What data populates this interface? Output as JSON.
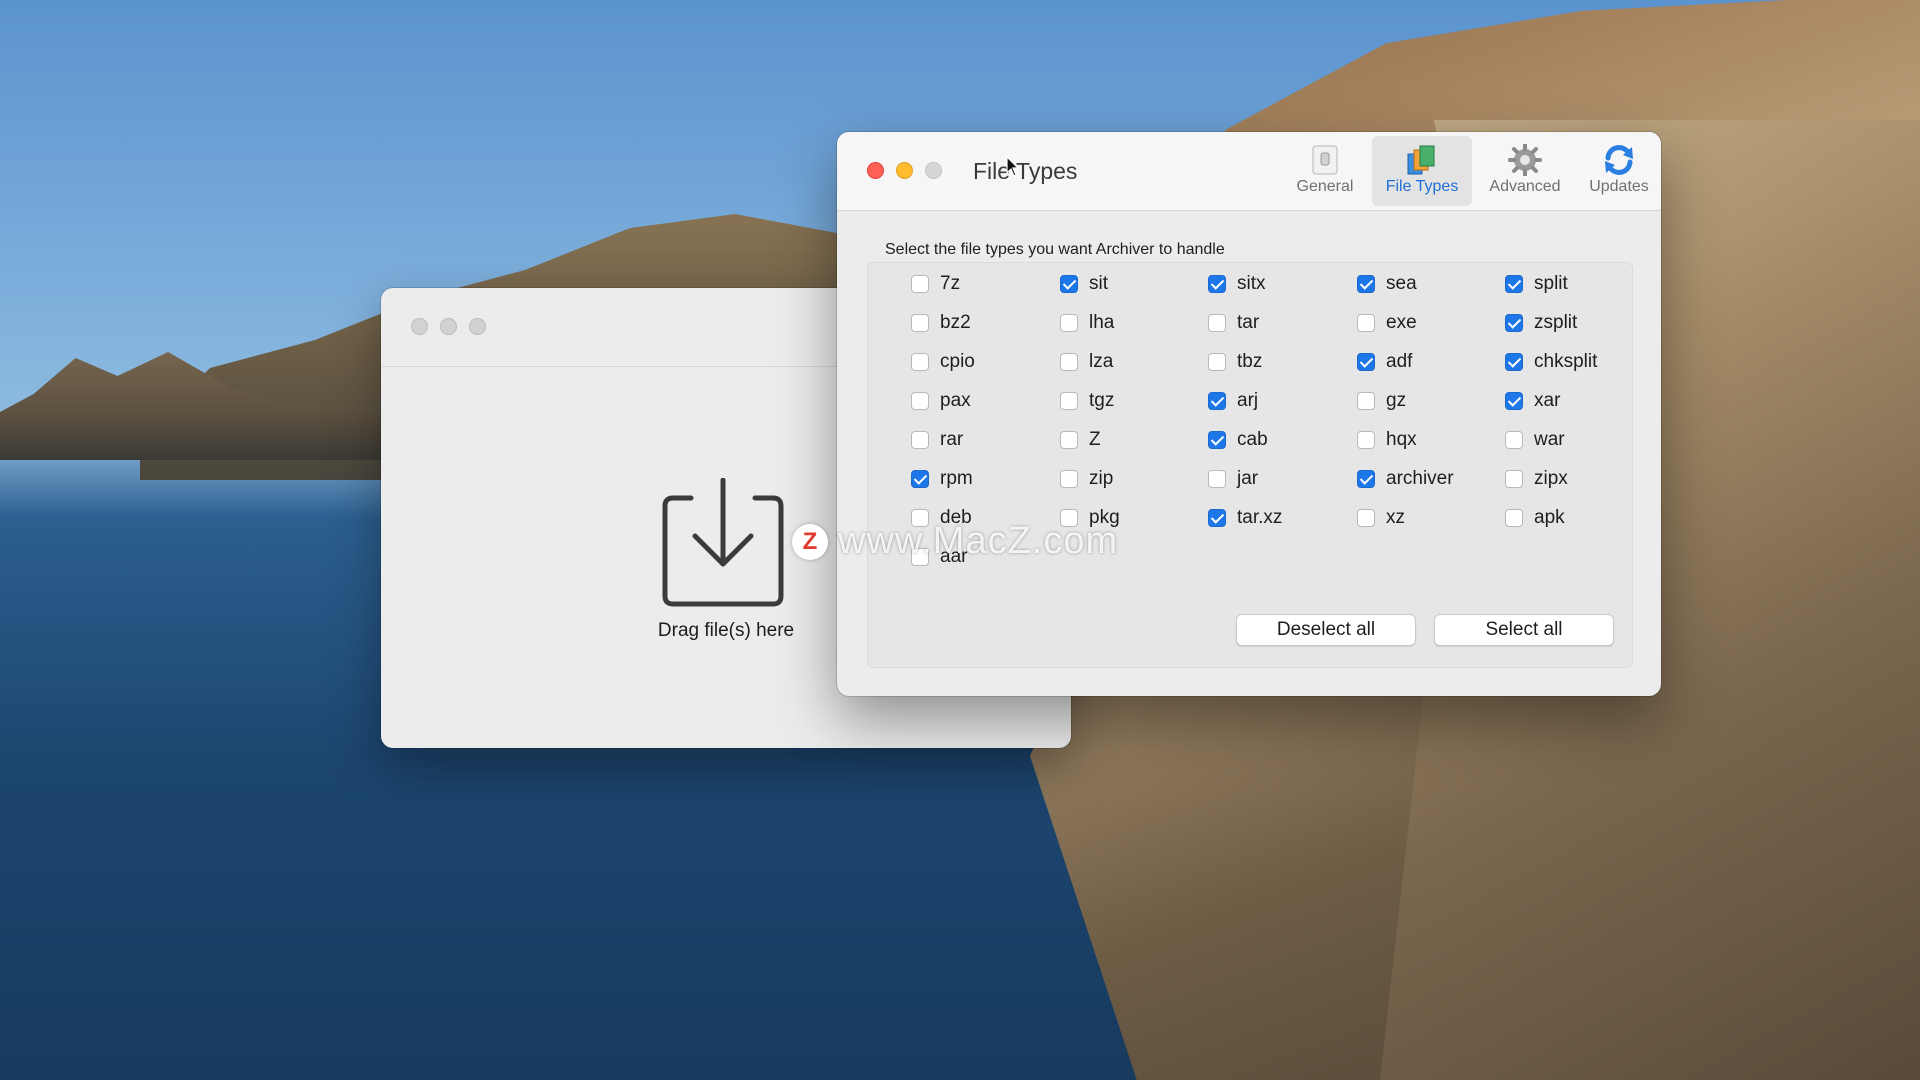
{
  "drop_window": {
    "label": "Drag file(s) here"
  },
  "prefs": {
    "title": "File Types",
    "toolbar": [
      {
        "id": "general",
        "label": "General",
        "icon": "switch-icon",
        "active": false
      },
      {
        "id": "filetypes",
        "label": "File Types",
        "icon": "stacked-files-icon",
        "active": true
      },
      {
        "id": "advanced",
        "label": "Advanced",
        "icon": "gear-icon",
        "active": false
      },
      {
        "id": "updates",
        "label": "Updates",
        "icon": "refresh-icon",
        "active": false
      }
    ],
    "instruction": "Select the file types you want Archiver to handle",
    "columns": [
      [
        {
          "label": "7z",
          "checked": false
        },
        {
          "label": "bz2",
          "checked": false
        },
        {
          "label": "cpio",
          "checked": false
        },
        {
          "label": "pax",
          "checked": false
        },
        {
          "label": "rar",
          "checked": false
        },
        {
          "label": "rpm",
          "checked": true
        },
        {
          "label": "deb",
          "checked": false
        },
        {
          "label": "aar",
          "checked": false
        }
      ],
      [
        {
          "label": "sit",
          "checked": true
        },
        {
          "label": "lha",
          "checked": false
        },
        {
          "label": "lza",
          "checked": false
        },
        {
          "label": "tgz",
          "checked": false
        },
        {
          "label": "Z",
          "checked": false
        },
        {
          "label": "zip",
          "checked": false
        },
        {
          "label": "pkg",
          "checked": false
        }
      ],
      [
        {
          "label": "sitx",
          "checked": true
        },
        {
          "label": "tar",
          "checked": false
        },
        {
          "label": "tbz",
          "checked": false
        },
        {
          "label": "arj",
          "checked": true
        },
        {
          "label": "cab",
          "checked": true
        },
        {
          "label": "jar",
          "checked": false
        },
        {
          "label": "tar.xz",
          "checked": true
        }
      ],
      [
        {
          "label": "sea",
          "checked": true
        },
        {
          "label": "exe",
          "checked": false
        },
        {
          "label": "adf",
          "checked": true
        },
        {
          "label": "gz",
          "checked": false
        },
        {
          "label": "hqx",
          "checked": false
        },
        {
          "label": "archiver",
          "checked": true
        },
        {
          "label": "xz",
          "checked": false
        }
      ],
      [
        {
          "label": "split",
          "checked": true
        },
        {
          "label": "zsplit",
          "checked": true
        },
        {
          "label": "chksplit",
          "checked": true
        },
        {
          "label": "xar",
          "checked": true
        },
        {
          "label": "war",
          "checked": false
        },
        {
          "label": "zipx",
          "checked": false
        },
        {
          "label": "apk",
          "checked": false
        }
      ]
    ],
    "deselect_all": "Deselect all",
    "select_all": "Select all"
  },
  "watermark": {
    "badge": "Z",
    "text": "www.MacZ.com"
  },
  "colors": {
    "accent": "#1e77e9",
    "close": "#fe5f57",
    "minimize": "#febc2e"
  }
}
